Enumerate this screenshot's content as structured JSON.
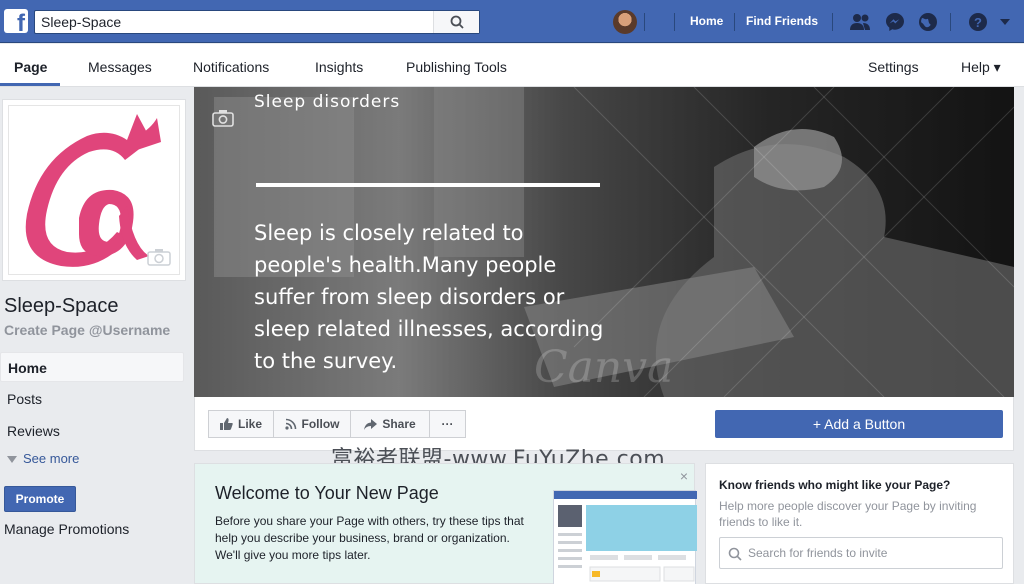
{
  "topbar": {
    "logo": "f",
    "search_value": "Sleep-Space",
    "nav_home": "Home",
    "nav_find_friends": "Find Friends",
    "brand_color": "#4267b2"
  },
  "subnav": {
    "tabs": [
      "Page",
      "Messages",
      "Notifications",
      "Insights",
      "Publishing Tools"
    ],
    "settings": "Settings",
    "help": "Help ▾"
  },
  "left": {
    "page_name": "Sleep-Space",
    "username": "Create Page @Username",
    "menu": [
      "Home",
      "Posts",
      "Reviews"
    ],
    "see_more": "See more",
    "promote": "Promote",
    "manage_promotions": "Manage Promotions"
  },
  "cover": {
    "title": "Sleep disorders",
    "body": "Sleep is closely related to people's health.Many people suffer from sleep disorders or sleep related illnesses, according to the survey.",
    "watermark": "Canva"
  },
  "actions": {
    "like": "Like",
    "follow": "Follow",
    "share": "Share",
    "more": "···",
    "add_button": "+ Add a Button"
  },
  "overlay_text": "富裕者联盟-www.FuYuZhe.com",
  "welcome": {
    "title": "Welcome to Your New Page",
    "desc": "Before you share your Page with others, try these tips that help you describe your business, brand or organization. We'll give you more tips later.",
    "close": "×"
  },
  "friends": {
    "title": "Know friends who might like your Page?",
    "desc": "Help more people discover your Page by inviting friends to like it.",
    "placeholder": "Search for friends to invite"
  }
}
